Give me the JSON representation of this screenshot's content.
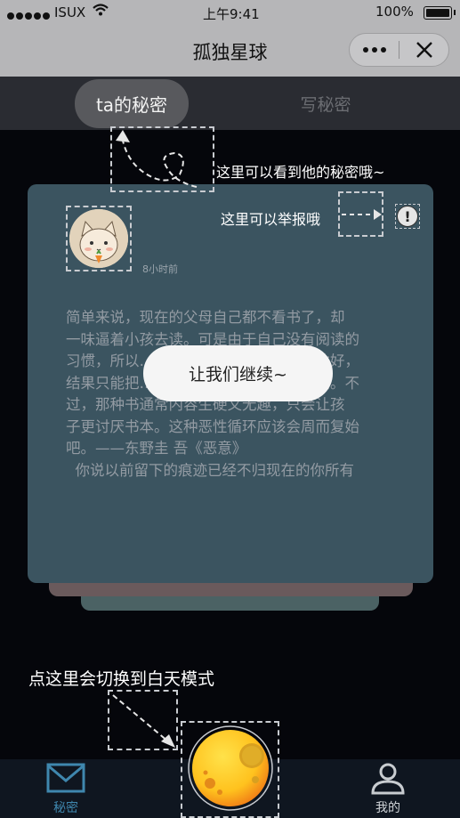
{
  "status_bar": {
    "carrier": "ISUX",
    "time": "上午9:41",
    "battery": "100%"
  },
  "nav": {
    "title": "孤独星球",
    "more_icon": "more-icon",
    "close_icon": "close-icon"
  },
  "top_tabs": {
    "active": "ta的秘密",
    "inactive": "写秘密"
  },
  "card": {
    "time_ago": "8小时前",
    "content": "简单来说，现在的父母自己都不看书了，却\n一味逼着小孩去读。可是由于自己没有阅读的\n习惯，所以…………………………什么才好，\n结果只能把…………………………给他们。不\n过，那种书通常内容生硬又无趣，只会让孩\n子更讨厌书本。这种恶性循环应该会周而复始\n吧。——东野圭 吾《恶意》\n  你说以前留下的痕迹已经不归现在的你所有"
  },
  "guides": {
    "tab_hint": "这里可以看到他的秘密哦~",
    "report_hint": "这里可以举报哦",
    "mode_hint": "点这里会切换到白天模式",
    "continue": "让我们继续~"
  },
  "tabbar": {
    "secret": "秘密",
    "mine": "我的"
  },
  "colors": {
    "accent": "#3f87ae",
    "card": "#3b5460",
    "background": "#05060b"
  }
}
